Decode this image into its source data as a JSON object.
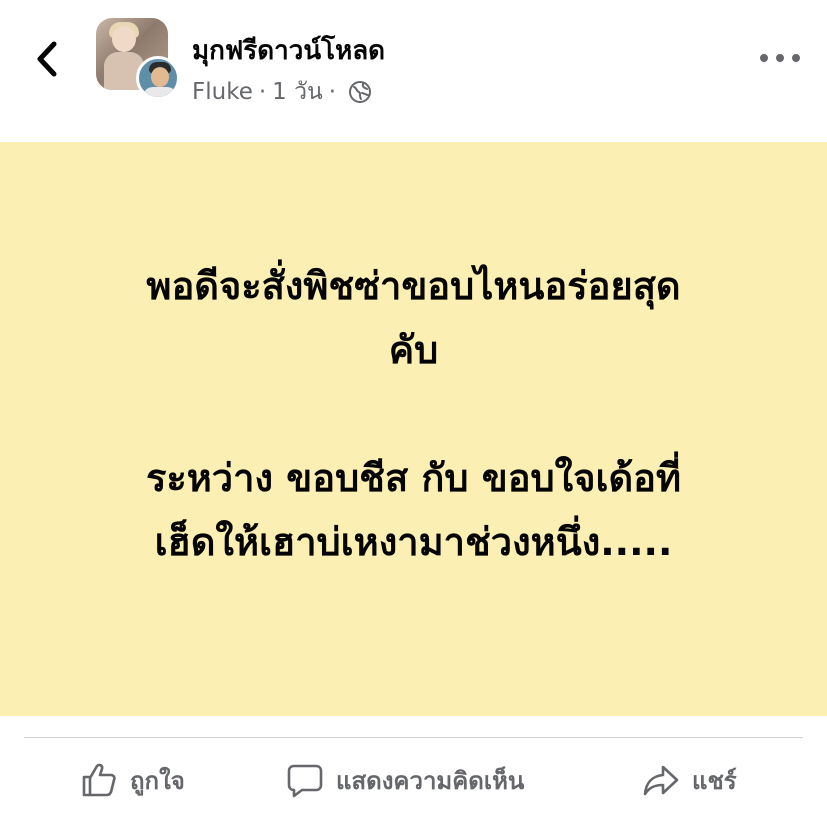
{
  "header": {
    "group_name": "มุกฟรีดาวน์โหลด",
    "author": "Fluke",
    "separator": "·",
    "time": "1 วัน",
    "icons": {
      "back": "chevron-left-icon",
      "privacy": "globe-icon",
      "more": "more-horizontal-icon"
    }
  },
  "post": {
    "background_color": "#fbefb4",
    "lines": [
      "พอดีจะสั่งพิชซ่าขอบไหนอร่อยสุด",
      "คับ",
      "",
      "ระหว่าง ขอบชีส กับ ขอบใจเด้อที่",
      "เฮ็ดให้เฮาบ่เหงามาช่วงหนึ่ง....."
    ]
  },
  "actions": {
    "like_label": "ถูกใจ",
    "comment_label": "แสดงความคิดเห็น",
    "share_label": "แชร์",
    "icons": {
      "like": "thumbs-up-icon",
      "comment": "comment-bubble-icon",
      "share": "share-arrow-icon"
    }
  },
  "colors": {
    "text_primary": "#050505",
    "text_secondary": "#65676b",
    "divider": "#ced0d4"
  }
}
